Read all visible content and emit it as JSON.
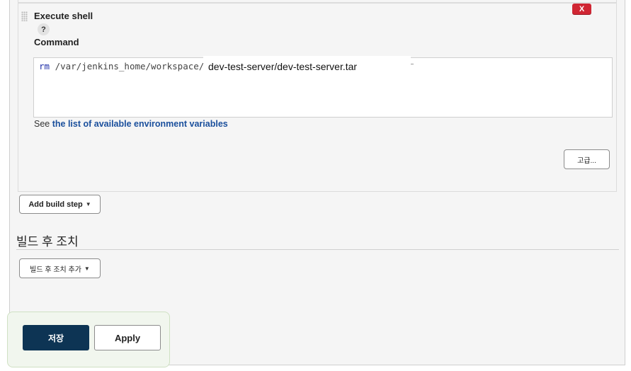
{
  "step": {
    "title": "Execute shell",
    "help": "?",
    "delete_label": "X",
    "command_label": "Command",
    "command_keyword": "rm",
    "command_path": " /var/jenkins_home/workspace/",
    "command_overlay": "dev-test-server/dev-test-server.tar",
    "see_prefix": "See ",
    "see_link": "the list of available environment variables",
    "advanced_label": "고급..."
  },
  "add_build_step_label": "Add build step",
  "post_build": {
    "title": "빌드 후 조치",
    "add_label": "빌드 후 조치 추가"
  },
  "footer": {
    "save_label": "저장",
    "apply_label": "Apply"
  },
  "colors": {
    "save_button": "#0d3454",
    "delete_button": "#d02633",
    "link": "#1a4f9c",
    "footer_panel": "#f1f6ee"
  }
}
